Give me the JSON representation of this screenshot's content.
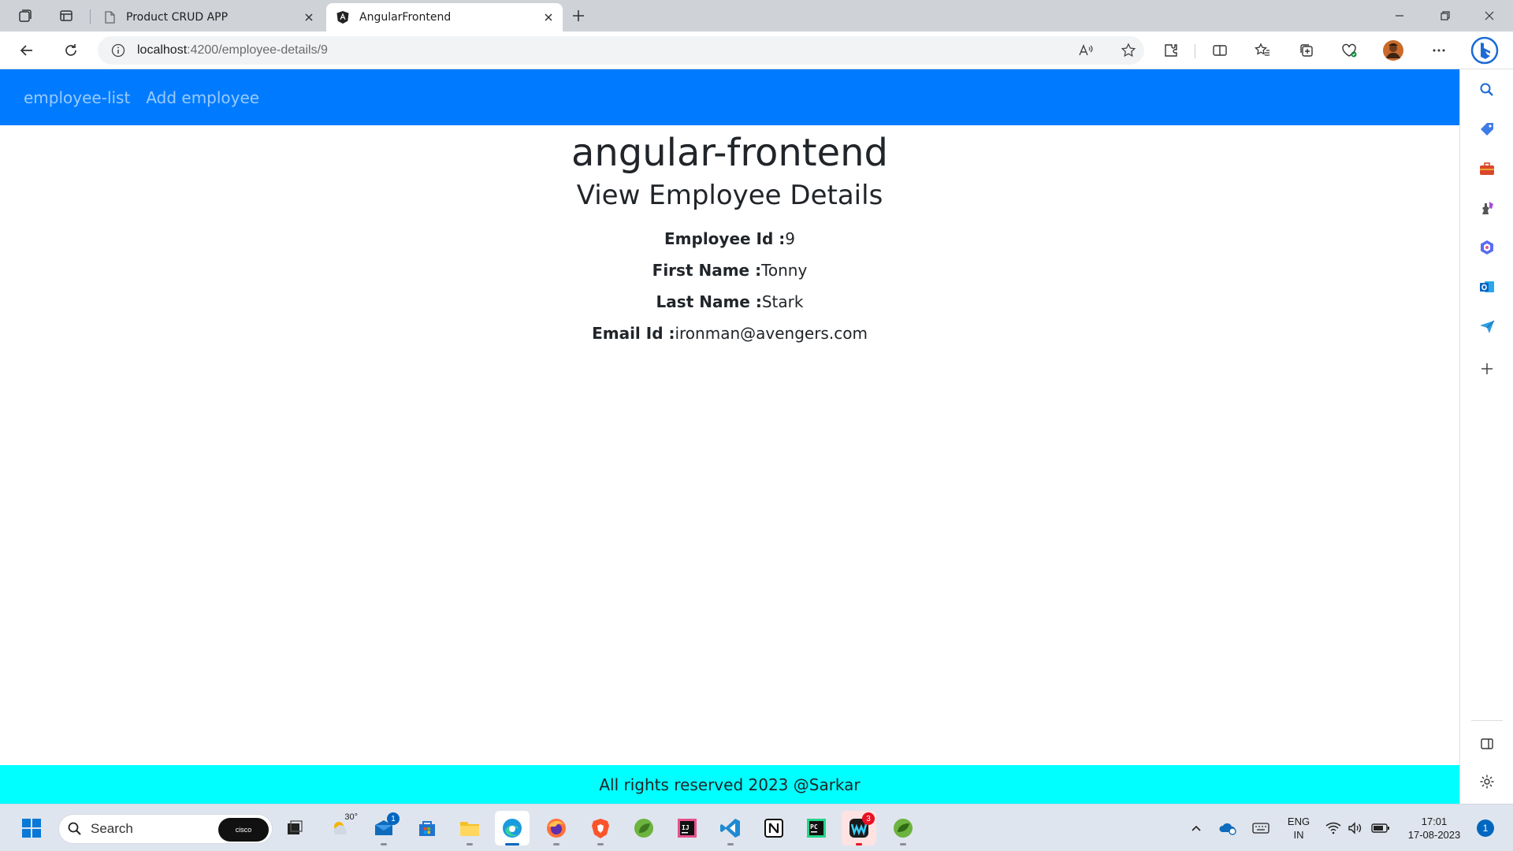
{
  "browser": {
    "tabs": [
      {
        "title": "Product CRUD APP",
        "active": false
      },
      {
        "title": "AngularFrontend",
        "active": true
      }
    ],
    "address": {
      "host": "localhost",
      "path": ":4200/employee-details/9"
    }
  },
  "app": {
    "nav": {
      "employee_list": "employee-list",
      "add_employee": "Add employee"
    },
    "title": "angular-frontend",
    "heading": "View Employee Details",
    "details": [
      {
        "label": "Employee Id :",
        "value": "9"
      },
      {
        "label": "First Name :",
        "value": "Tonny"
      },
      {
        "label": "Last Name :",
        "value": "Stark"
      },
      {
        "label": "Email Id :",
        "value": "ironman@avengers.com"
      }
    ],
    "footer": "All rights reserved 2023 @Sarkar"
  },
  "taskbar": {
    "search_label": "Search",
    "search_widget": "cisco",
    "weather_temp": "30°",
    "mail_badge": "1",
    "webex_badge": "3",
    "language_line1": "ENG",
    "language_line2": "IN",
    "time": "17:01",
    "date": "17-08-2023",
    "notification_count": "1"
  },
  "colors": {
    "navbar": "#007bff",
    "footer": "#00ffff",
    "accent": "#0067c0"
  }
}
